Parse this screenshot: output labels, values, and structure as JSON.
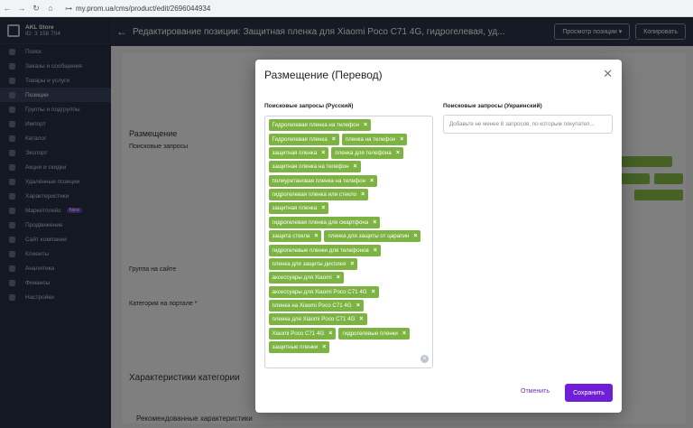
{
  "browser": {
    "url": "my.prom.ua/cms/product/edit/2696044934"
  },
  "store": {
    "name": "AKL Store",
    "id": "ID: 3 156 704"
  },
  "sidebar": {
    "items": [
      {
        "label": "Поиск"
      },
      {
        "label": "Заказы и сообщения"
      },
      {
        "label": "Товары и услуги"
      },
      {
        "label": "Позиции",
        "active": true
      },
      {
        "label": "Группы и подгруппы"
      },
      {
        "label": "Импорт"
      },
      {
        "label": "Каталог"
      },
      {
        "label": "Экспорт"
      },
      {
        "label": "Акции и скидки"
      },
      {
        "label": "Удалённые позиции"
      },
      {
        "label": "Характеристики"
      },
      {
        "label": "Маркетплейс",
        "badge": "New"
      },
      {
        "label": "Продвижение"
      },
      {
        "label": "Сайт компании"
      },
      {
        "label": "Клиенты"
      },
      {
        "label": "Аналитика"
      },
      {
        "label": "Финансы"
      },
      {
        "label": "Настройки"
      }
    ]
  },
  "topbar": {
    "title": "Редактирование позиции: Защитная пленка для Xiaomi Poco C71 4G, гидрогелевая, уд...",
    "preview_label": "Просмотр позиции",
    "copy_label": "Копировать"
  },
  "content": {
    "section_title": "Размещение",
    "search_queries_label": "Поисковые запросы",
    "group_label": "Группа на сайте",
    "category_label": "Категория на портале *",
    "characteristics_title": "Характеристики категории",
    "recommended_title": "Рекомендованные характеристики"
  },
  "modal": {
    "title": "Размещение (Перевод)",
    "ru_label": "Поисковые запросы (Русский)",
    "ua_label": "Поисковые запросы (Украинский)",
    "ua_placeholder": "Добавьте не менее 8 запросов, по которым покупател...",
    "cancel_label": "Отменить",
    "save_label": "Сохранить",
    "tag_color": "#7cb342",
    "save_color": "#6f1fd6",
    "tags": [
      "Гидрогелевая пленка на телефон",
      "Гидрогелевая пленка",
      "пленка на телефон",
      "защитная пленка",
      "пленка для телефона",
      "защитная пленка на телефон",
      "полиуретановая пленка на телефон",
      "гидрогелевая пленка или стекло",
      "защитная пленка",
      "гидрогелевая пленка для смартфона",
      "защита стекла",
      "пленка для защиты от царапин",
      "гидрогелевые пленки для телефонов",
      "пленка для защиты дисплея",
      "аксессуары для Xiaomi",
      "аксессуары для Xiaomi Poco C71 4G",
      "пленка на Xiaomi Poco C71 4G",
      "пленка для Xiaomi Poco C71 4G",
      "Xiaomi Poco C71 4G",
      "гидрогелевые пленки",
      "защитные пленки"
    ]
  }
}
